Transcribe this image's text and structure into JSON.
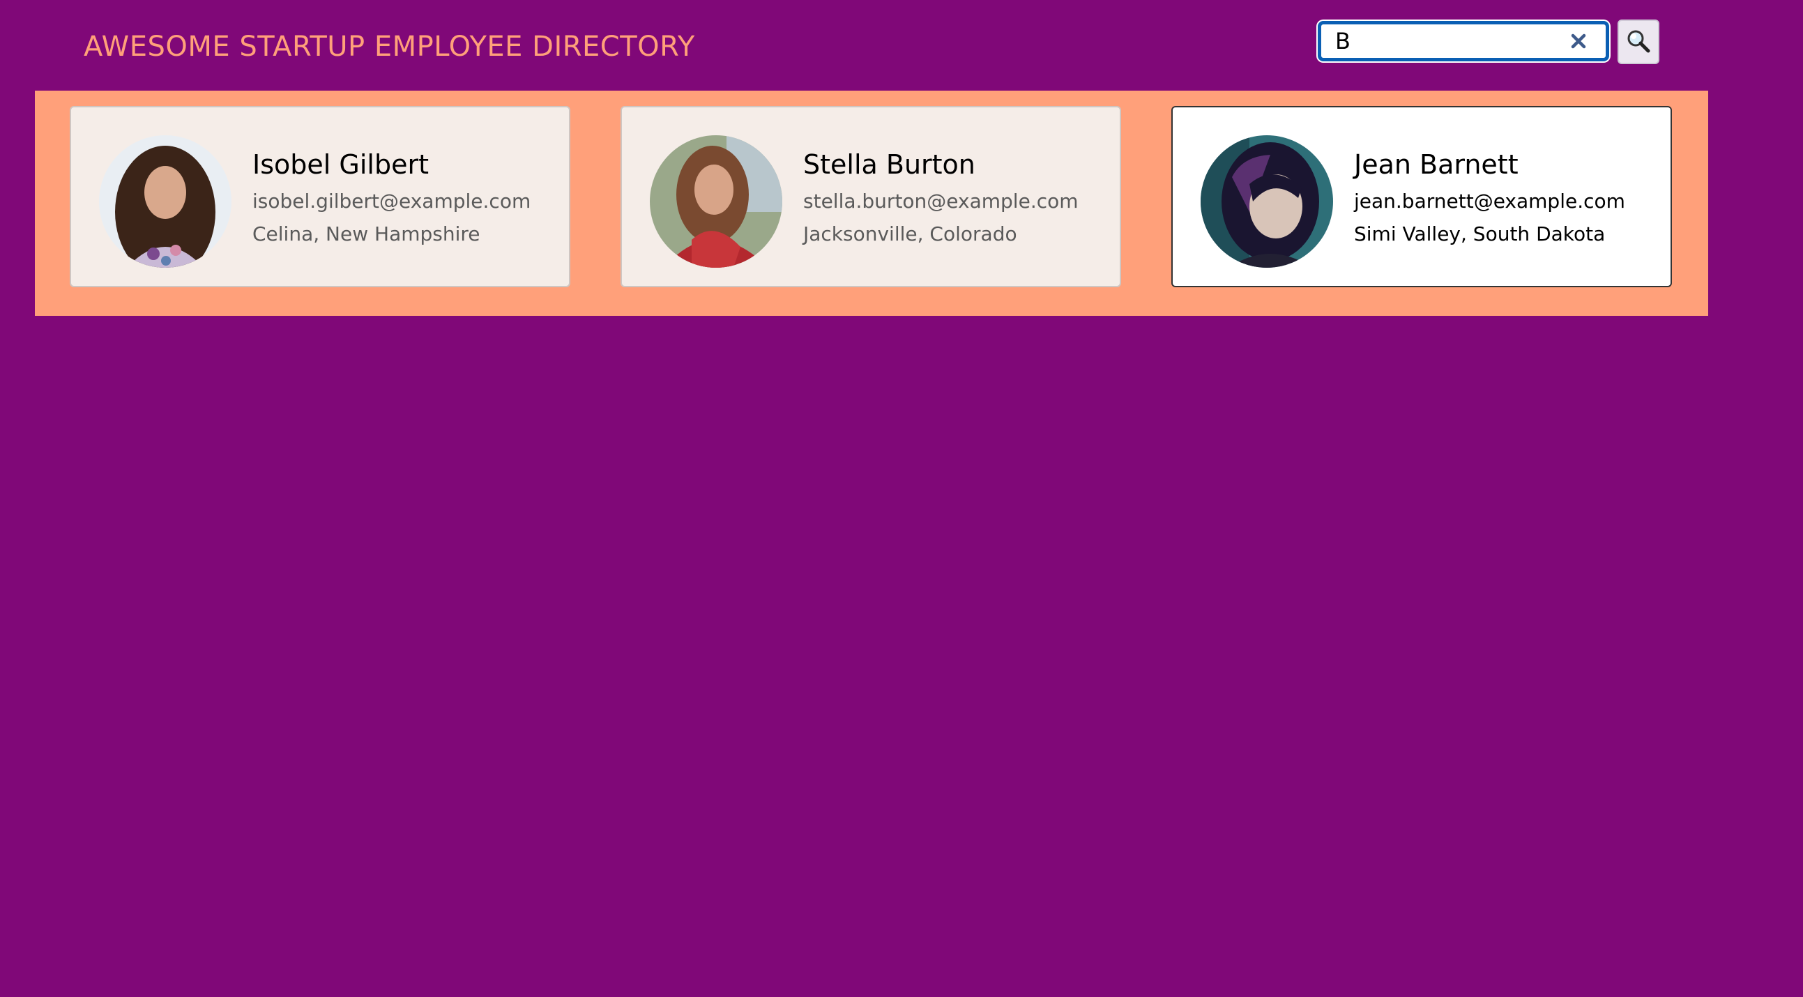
{
  "header": {
    "title": "AWESOME STARTUP EMPLOYEE DIRECTORY"
  },
  "search": {
    "value": "B",
    "clear_icon": "close-icon",
    "button_icon": "search-icon"
  },
  "colors": {
    "background": "#800878",
    "accent": "#FFA07A",
    "card": "#F5EDE8",
    "card_active": "#FFFFFF",
    "focus_ring": "#0A5FB4"
  },
  "employees": [
    {
      "name": "Isobel Gilbert",
      "email": "isobel.gilbert@example.com",
      "location": "Celina, New Hampshire",
      "active": false
    },
    {
      "name": "Stella Burton",
      "email": "stella.burton@example.com",
      "location": "Jacksonville, Colorado",
      "active": false
    },
    {
      "name": "Jean Barnett",
      "email": "jean.barnett@example.com",
      "location": "Simi Valley, South Dakota",
      "active": true
    }
  ]
}
